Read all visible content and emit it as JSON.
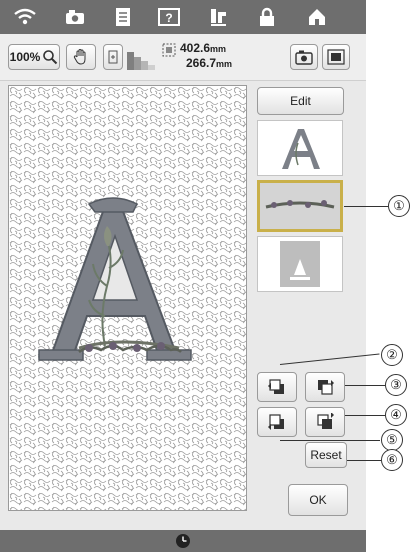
{
  "topbar": {
    "icons": [
      "wifi-icon",
      "camera-icon",
      "document-icon",
      "help-icon",
      "thread-icon",
      "lock-icon",
      "home-icon"
    ]
  },
  "toolbar": {
    "zoom_label": "100%",
    "size_width": "402.6",
    "size_height": "266.7",
    "size_unit": "mm"
  },
  "side": {
    "edit_label": "Edit",
    "reset_label": "Reset",
    "ok_label": "OK"
  },
  "callouts": [
    "①",
    "②",
    "③",
    "④",
    "⑤",
    "⑥"
  ],
  "colors": {
    "topbar": "#6e6e6e",
    "selection": "#c9b04a",
    "letter": "#7c8088"
  }
}
